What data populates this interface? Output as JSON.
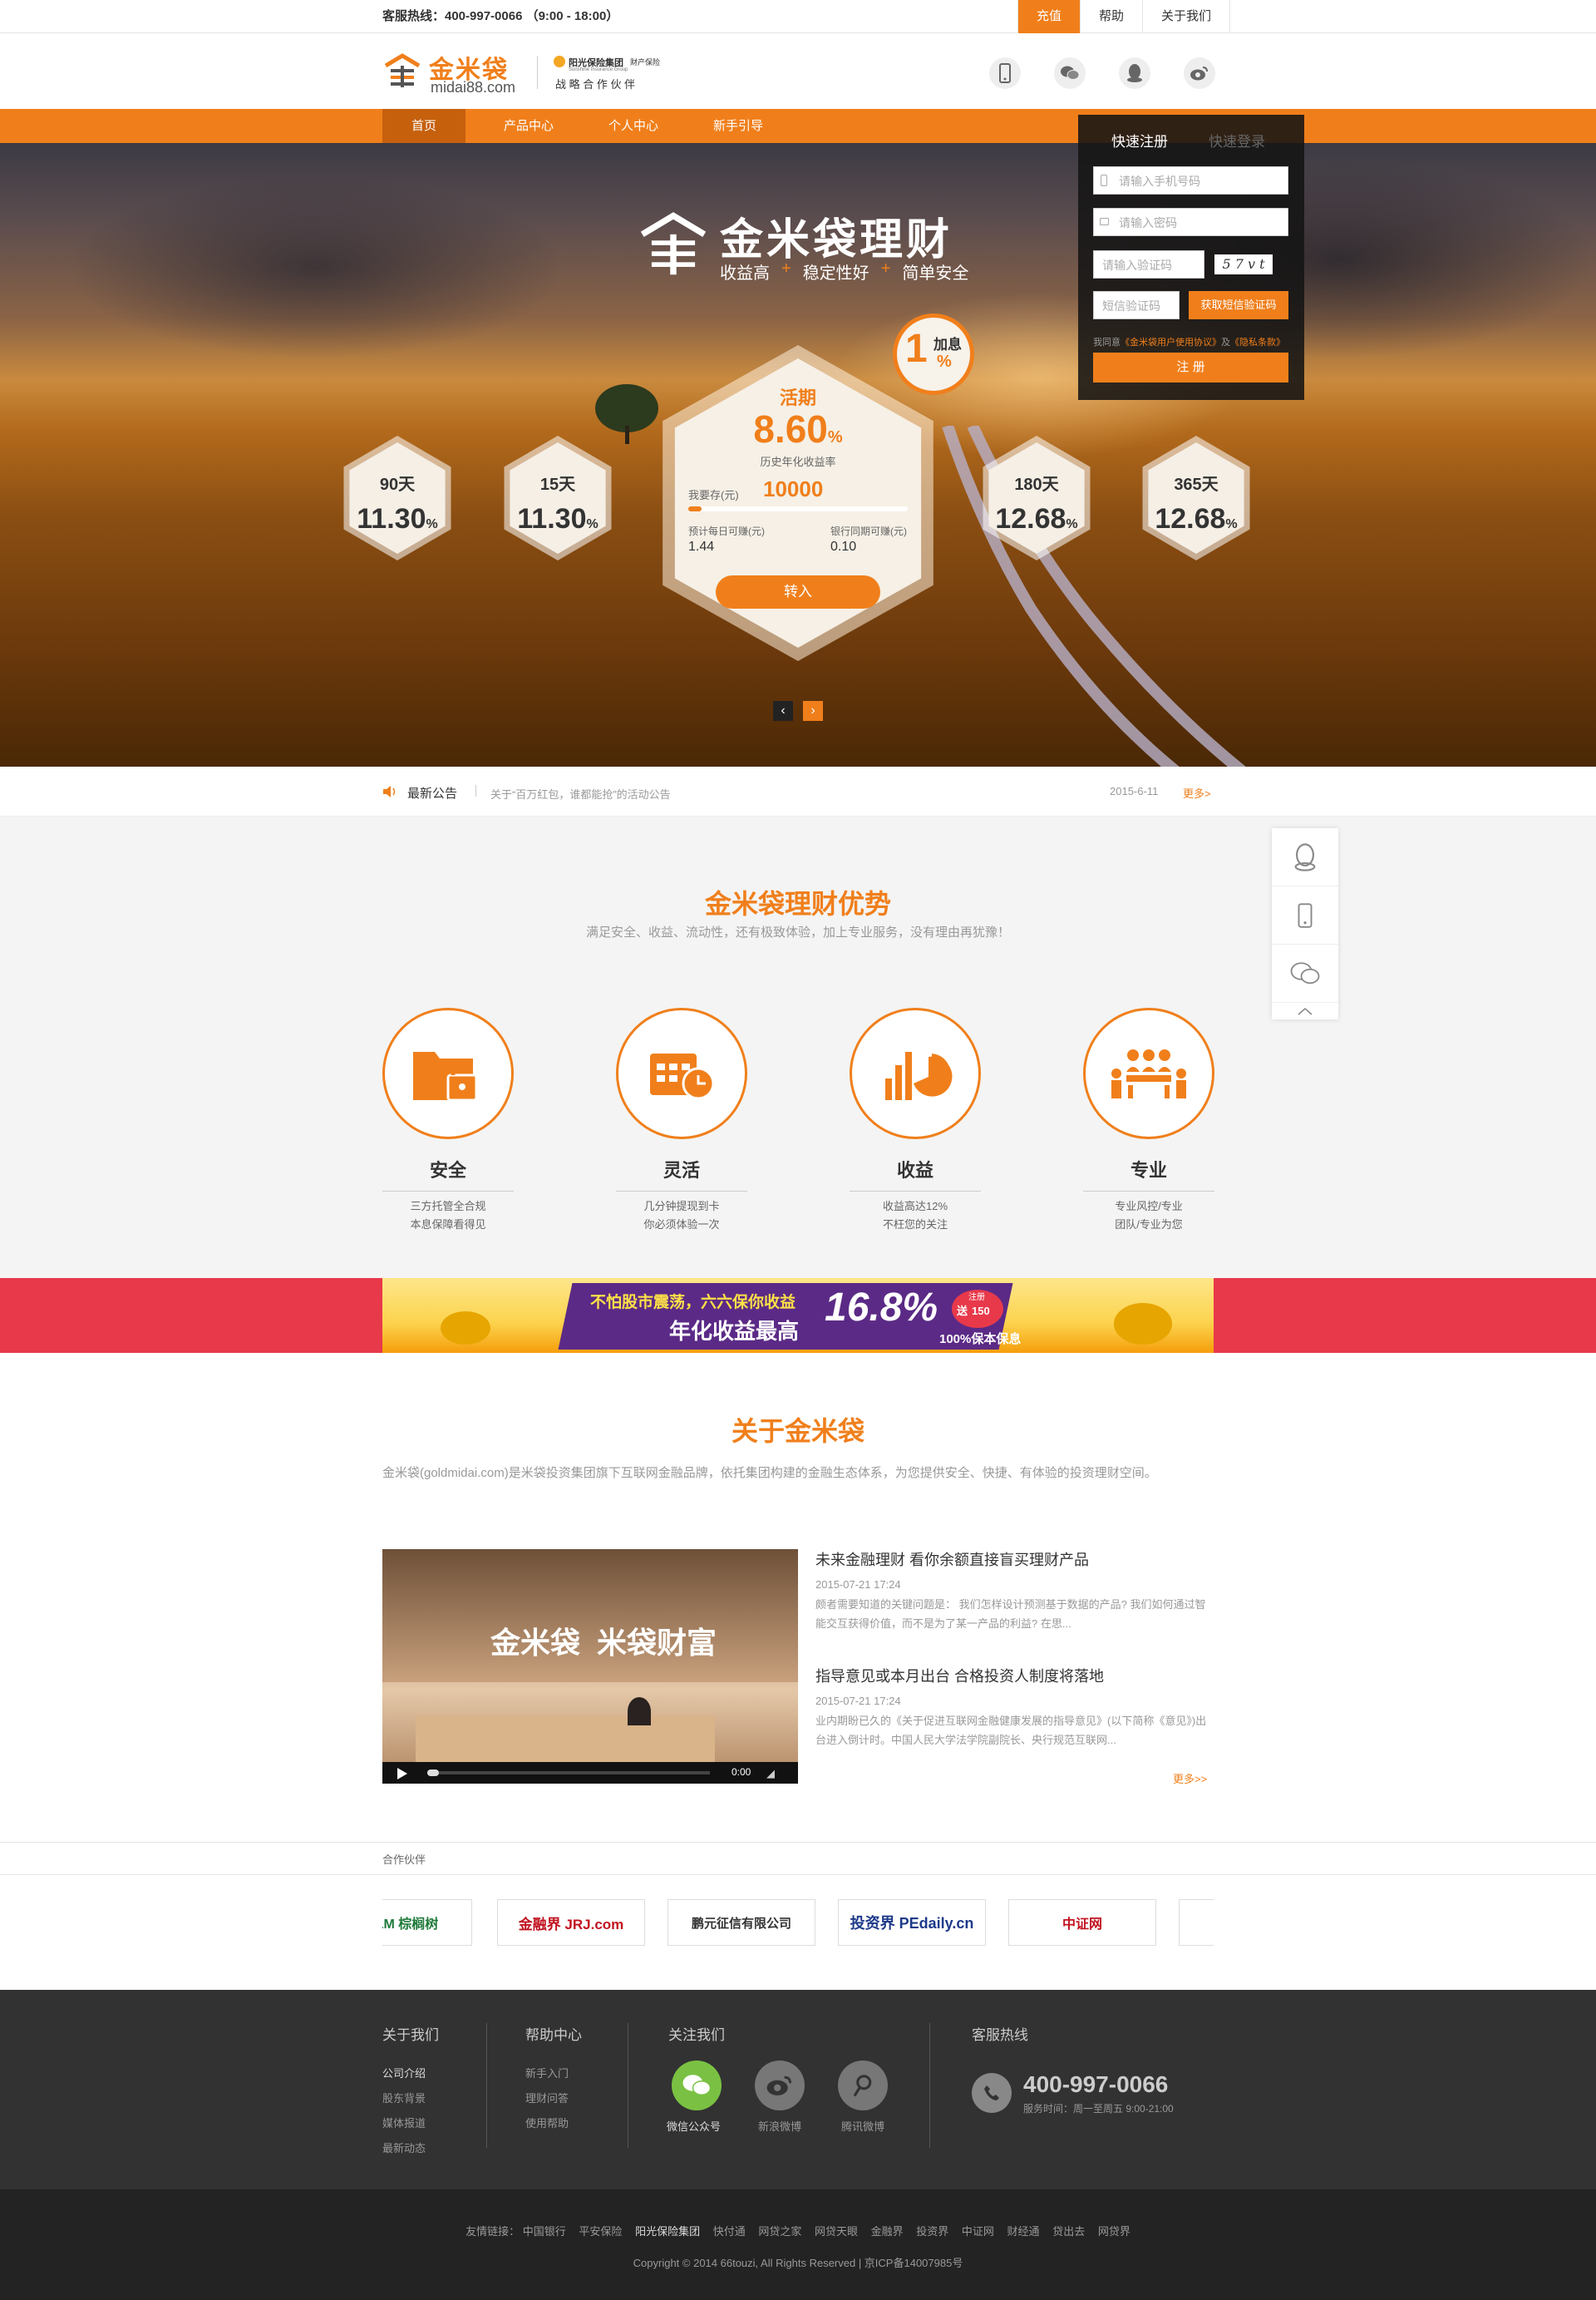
{
  "topbar": {
    "hotline": "客服热线：400-997-0066 （9:00 - 18:00）",
    "links": [
      {
        "label": "充值",
        "active": true
      },
      {
        "label": "帮助",
        "active": false
      },
      {
        "label": "关于我们",
        "active": false
      }
    ]
  },
  "header": {
    "logo_text": "金米袋",
    "logo_domain": "midai88.com",
    "partner_name": "阳光保险集团",
    "partner_en": "Sunshine Insurance Group",
    "partner_tag": "财产保险",
    "partner_slogan": "战 略 合 作 伙 伴",
    "icons": [
      "mobile-icon",
      "wechat-icon",
      "qq-icon",
      "weibo-icon"
    ]
  },
  "nav": {
    "items": [
      {
        "label": "首页",
        "active": true
      },
      {
        "label": "产品中心",
        "active": false
      },
      {
        "label": "个人中心",
        "active": false
      },
      {
        "label": "新手引导",
        "active": false
      }
    ]
  },
  "hero": {
    "brand": "金米袋理财",
    "tags": [
      "收益高",
      "稳定性好",
      "简单安全"
    ],
    "bonus_num": "1",
    "bonus_unit": "%",
    "bonus_label": "加息",
    "products": [
      {
        "days": "90天",
        "rate": "11.30",
        "unit": "%"
      },
      {
        "days": "15天",
        "rate": "11.30",
        "unit": "%"
      },
      {
        "days": "180天",
        "rate": "12.68",
        "unit": "%"
      },
      {
        "days": "365天",
        "rate": "12.68",
        "unit": "%"
      }
    ],
    "main": {
      "title": "活期",
      "rate": "8.60",
      "unit": "%",
      "rate_label": "历史年化收益率",
      "deposit_label": "我要存(元)",
      "deposit_value": "10000",
      "daily_label": "预计每日可赚(元)",
      "daily_value": "1.44",
      "bank_label": "银行同期可赚(元)",
      "bank_value": "0.10",
      "button": "转入"
    },
    "carousel": {
      "prev": "‹",
      "next": "›"
    }
  },
  "register": {
    "tab_register": "快速注册",
    "tab_login": "快速登录",
    "phone_placeholder": "请输入手机号码",
    "password_placeholder": "请输入密码",
    "captcha_placeholder": "请输入验证码",
    "captcha_text": "5 7 v t",
    "sms_placeholder": "短信验证码",
    "sms_button": "获取短信验证码",
    "agree_prefix": "我同意",
    "agree_link1": "《金米袋用户使用协议》",
    "agree_and": "及",
    "agree_link2": "《隐私条款》",
    "submit": "注 册"
  },
  "notice": {
    "label": "最新公告",
    "text": "关于“百万红包，谁都能抢”的活动公告",
    "date": "2015-6-11",
    "more": "更多>"
  },
  "advantages": {
    "title": "金米袋理财优势",
    "subtitle": "满足安全、收益、流动性，还有极致体验，加上专业服务，没有理由再犹豫！",
    "items": [
      {
        "title": "安全",
        "line1": "三方托管全合规",
        "line2": "本息保障看得见",
        "icon": "folder-lock-icon"
      },
      {
        "title": "灵活",
        "line1": "几分钟提现到卡",
        "line2": "你必须体验一次",
        "icon": "calendar-clock-icon"
      },
      {
        "title": "收益",
        "line1": "收益高达12%",
        "line2": "不枉您的关注",
        "icon": "chart-icon"
      },
      {
        "title": "专业",
        "line1": "专业风控/专业",
        "line2": "团队/专业为您",
        "icon": "team-icon"
      }
    ]
  },
  "banner": {
    "line1": "不怕股市震荡，六六保你收益",
    "line2": "年化收益最高",
    "rate": "16.8%",
    "badge_top": "注册",
    "badge_send": "送",
    "badge_num": "150",
    "guarantee": "100%保本保息"
  },
  "about": {
    "title": "关于金米袋",
    "desc": "金米袋(goldmidai.com)是米袋投资集团旗下互联网金融品牌，依托集团构建的金融生态体系，为您提供安全、快捷、有体验的投资理财空间。",
    "video_overlay": "金米袋  米袋财富",
    "video_time": "0:00",
    "news": [
      {
        "title": "未来金融理财 看你余额直接盲买理财产品",
        "date": "2015-07-21 17:24",
        "body": "颇者需要知道的关键问题是： 我们怎样设计预测基于数据的产品? 我们如何通过智能交互获得价值，而不是为了某一产品的利益? 在思..."
      },
      {
        "title": "指导意见或本月出台 合格投资人制度将落地",
        "date": "2015-07-21 17:24",
        "body": "业内期盼已久的《关于促进互联网金融健康发展的指导意见》(以下简称《意见》)出台进入倒计时。中国人民大学法学院副院长、央行规范互联网..."
      }
    ],
    "more": "更多>>"
  },
  "partners": {
    "label": "合作伙伴",
    "logos": [
      "PALM 棕榈树",
      "金融界 JRJ.com",
      "鹏元征信有限公司",
      "投资界 PEdaily.cn",
      "中证网",
      ""
    ]
  },
  "footer": {
    "col1": {
      "title": "关于我们",
      "links": [
        "公司介绍",
        "股东背景",
        "媒体报道",
        "最新动态"
      ]
    },
    "col2": {
      "title": "帮助中心",
      "links": [
        "新手入门",
        "理财问答",
        "使用帮助"
      ]
    },
    "col3": {
      "title": "关注我们",
      "items": [
        "微信公众号",
        "新浪微博",
        "腾讯微博"
      ]
    },
    "col4": {
      "title": "客服热线",
      "phone": "400-997-0066",
      "hours": "服务时间：周一至周五 9:00-21:00"
    }
  },
  "friend_links": {
    "label": "友情链接：",
    "links": [
      "中国银行",
      "平安保险",
      "阳光保险集团",
      "快付通",
      "网贷之家",
      "网贷天眼",
      "金融界",
      "投资界",
      "中证网",
      "财经通",
      "贷出去",
      "网贷界"
    ],
    "copyright": "Copyright © 2014 66touzi, All Rights Reserved | 京ICP备14007985号"
  },
  "colors": {
    "accent": "#f07f1b",
    "nav_active": "#c6600d",
    "footer": "#323232",
    "banner": "#e8394b"
  }
}
